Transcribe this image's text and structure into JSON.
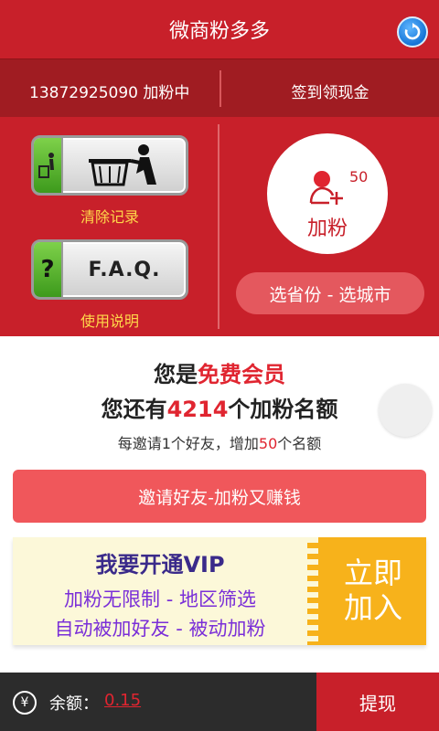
{
  "header": {
    "title": "微商粉多多",
    "refresh_icon": "refresh-icon"
  },
  "info": {
    "phone_status": "13872925090 加粉中",
    "checkin": "签到领现金"
  },
  "actions": {
    "clear_label": "清除记录",
    "faq_text": "F.A.Q.",
    "faq_label": "使用说明",
    "add_count": "50",
    "add_label": "加粉",
    "region_button": "选省份 - 选城市"
  },
  "membership": {
    "line1_prefix": "您是",
    "line1_highlight": "免费会员",
    "line2_prefix": "您还有",
    "line2_number": "4214",
    "line2_suffix": "个加粉名额",
    "line3_prefix": "每邀请1个好友，增加",
    "line3_number": "50",
    "line3_suffix": "个名额"
  },
  "invite_button": "邀请好友-加粉又赚钱",
  "vip": {
    "title": "我要开通VIP",
    "line1": "加粉无限制 - 地区筛选",
    "line2": "自动被加好友 - 被动加粉",
    "join_line1": "立即",
    "join_line2": "加入"
  },
  "footer": {
    "currency_symbol": "¥",
    "balance_label": "余额：",
    "balance": "0.15",
    "withdraw": "提现"
  },
  "colors": {
    "primary_red": "#c8202a",
    "dark_red": "#a01c22",
    "highlight_red": "#e02530",
    "gold": "#f7b21b",
    "vip_purple": "#7a2fd8"
  }
}
